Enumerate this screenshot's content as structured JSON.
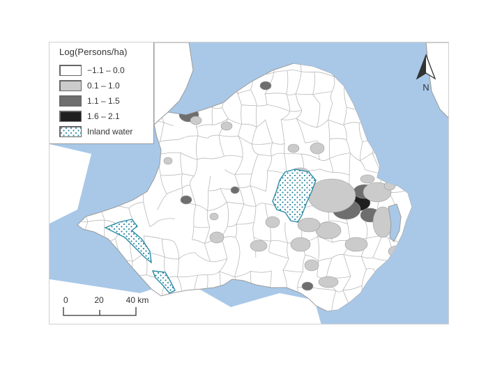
{
  "legend": {
    "title": "Log(Persons/ha)",
    "items": [
      {
        "label": "−1.1 – 0.0",
        "color": "#ffffff",
        "pattern": "none"
      },
      {
        "label": "0.1 – 1.0",
        "color": "#cbcbcb",
        "pattern": "none"
      },
      {
        "label": "1.1 – 1.5",
        "color": "#6e6e6e",
        "pattern": "none"
      },
      {
        "label": "1.6 – 2.1",
        "color": "#1f1f1f",
        "pattern": "none"
      },
      {
        "label": "Inland water",
        "color": "#ffffff",
        "pattern": "dots",
        "dot_color": "#2a8aa6"
      }
    ]
  },
  "north_arrow": {
    "label": "N"
  },
  "scale_bar": {
    "ticks": [
      "0",
      "20",
      "40 km"
    ]
  },
  "colors": {
    "sea": "#a9c8e8",
    "land": "#ffffff",
    "boundary": "#b9b9b9",
    "coast": "#9a9a9a",
    "water_dot": "#2a8aa6"
  }
}
